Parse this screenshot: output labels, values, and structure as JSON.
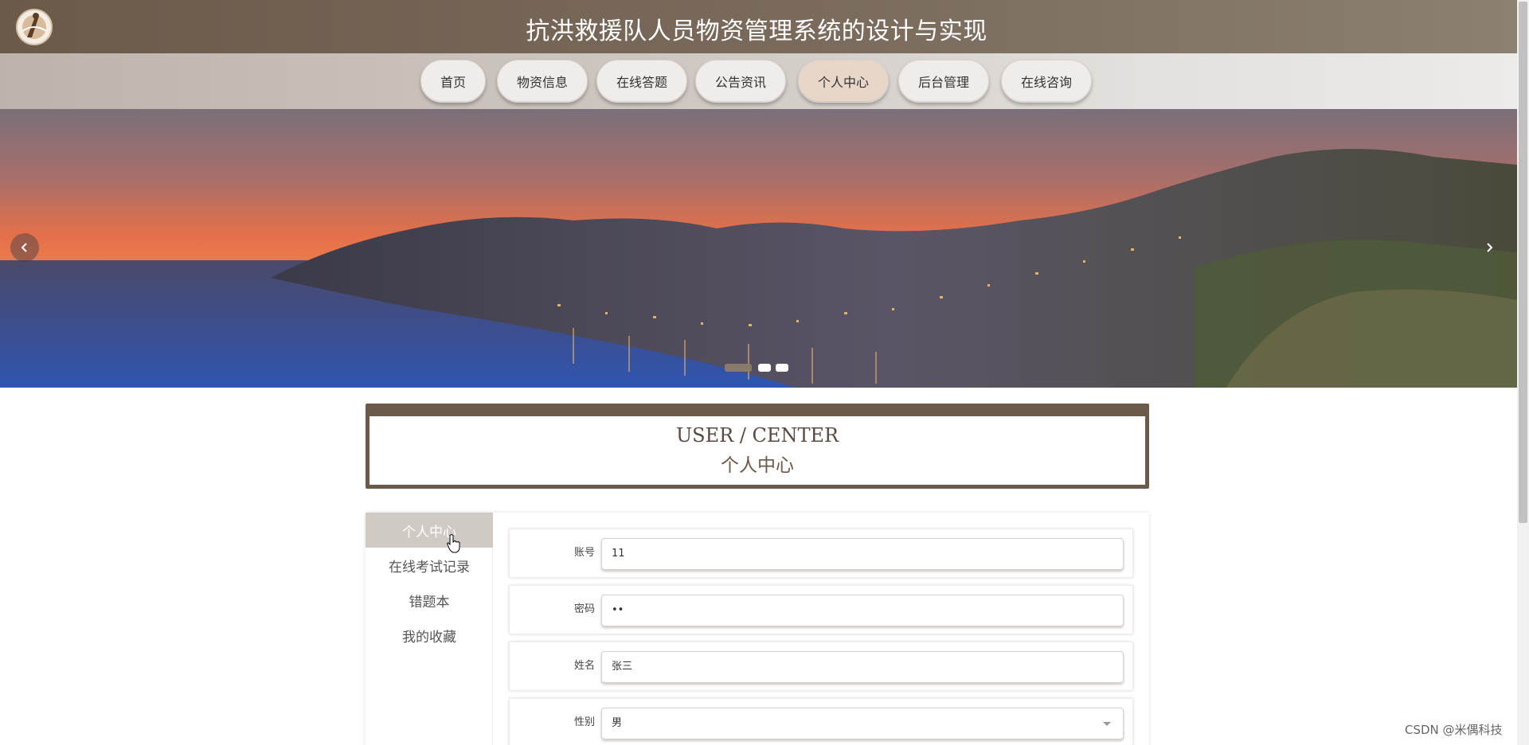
{
  "header": {
    "title": "抗洪救援队人员物资管理系统的设计与实现"
  },
  "nav": {
    "items": [
      {
        "label": "首页"
      },
      {
        "label": "物资信息"
      },
      {
        "label": "在线答题"
      },
      {
        "label": "公告资讯"
      },
      {
        "label": "个人中心",
        "active": true
      },
      {
        "label": "后台管理"
      },
      {
        "label": "在线咨询"
      }
    ]
  },
  "banner": {
    "slide_count": 3,
    "active_slide": 1
  },
  "section": {
    "title_en": "USER / CENTER",
    "title_cn": "个人中心"
  },
  "sidebar": {
    "items": [
      {
        "label": "个人中心",
        "active": true
      },
      {
        "label": "在线考试记录"
      },
      {
        "label": "错题本"
      },
      {
        "label": "我的收藏"
      }
    ]
  },
  "form": {
    "fields": [
      {
        "label": "账号",
        "value": "11"
      },
      {
        "label": "密码",
        "value": "••"
      },
      {
        "label": "姓名",
        "value": "张三"
      },
      {
        "label": "性别",
        "value": "男"
      }
    ]
  },
  "watermark": "CSDN @米偶科技",
  "colors": {
    "primary": "#6b5a4a",
    "nav_active": "#e8d7c8",
    "sidebar_active": "#d0cac5"
  },
  "icons": [
    "logo-icon",
    "chevron-left-icon",
    "chevron-right-icon",
    "chevron-down-icon",
    "pointer-cursor-icon"
  ]
}
